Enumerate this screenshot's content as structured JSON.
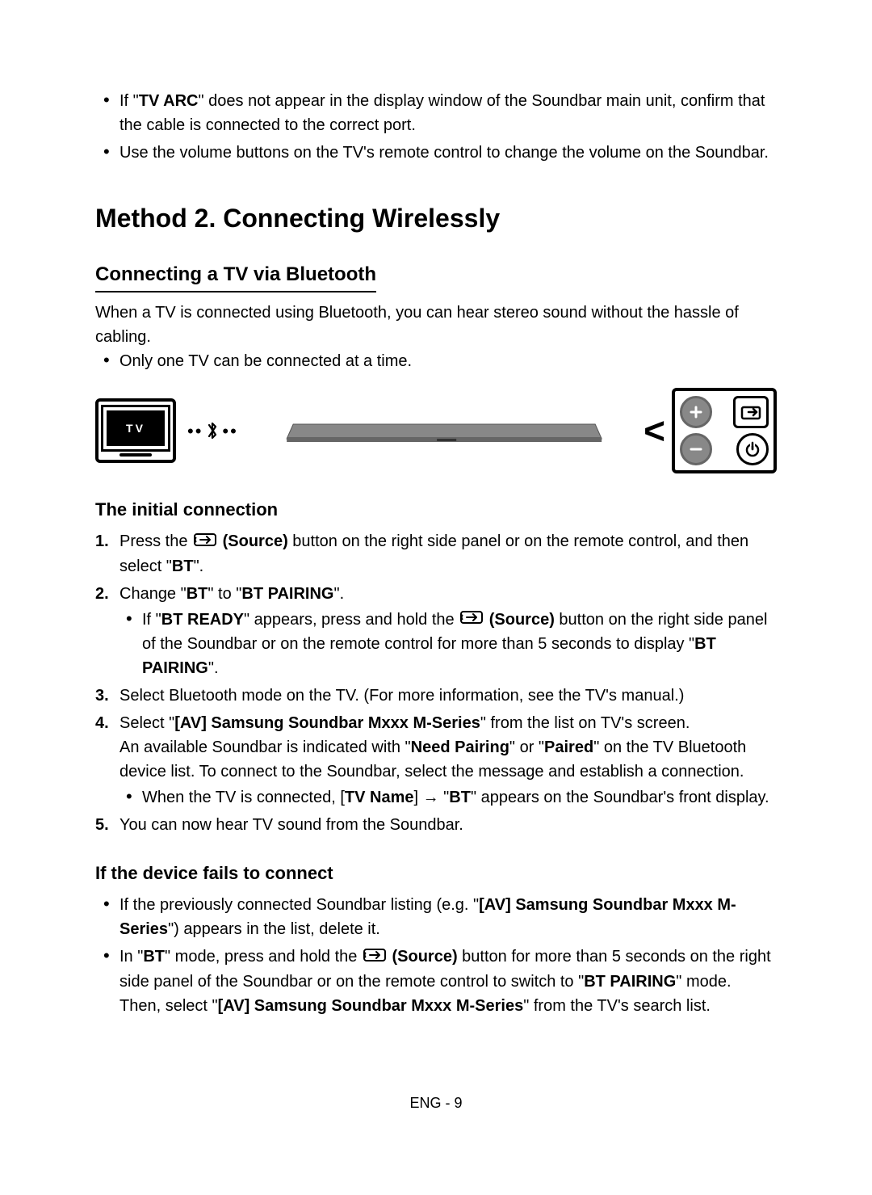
{
  "intro_bullets": [
    {
      "pre": "If \"",
      "bold1": "TV ARC",
      "post": "\" does not appear in the display window of the Soundbar main unit, confirm that the cable is connected to the correct port."
    },
    {
      "plain": "Use the volume buttons on the TV's remote control to change the volume on the Soundbar."
    }
  ],
  "method_title": "Method 2. Connecting Wirelessly",
  "subsection": "Connecting a TV via Bluetooth",
  "sub_desc": "When a TV is connected using Bluetooth, you can hear stereo sound without the hassle of cabling.",
  "sub_bullet": "Only one TV can be connected at a time.",
  "diagram": {
    "tv_label": "TV"
  },
  "initial_conn_title": "The initial connection",
  "source_label": "(Source)",
  "steps": {
    "s1_a": "Press the ",
    "s1_b": " button on the right side panel or on the remote control, and then select \"",
    "s1_bold": "BT",
    "s1_c": "\".",
    "s2_a": "Change \"",
    "s2_b1": "BT",
    "s2_b": "\" to \"",
    "s2_b2": "BT PAIRING",
    "s2_c": "\".",
    "s2_sub_a": "If \"",
    "s2_sub_b": "BT READY",
    "s2_sub_c": "\" appears, press and hold the ",
    "s2_sub_d": " button on the right side panel of the Soundbar or on the remote control for more than 5 seconds to display \"",
    "s2_sub_e": "BT PAIRING",
    "s2_sub_f": "\".",
    "s3": "Select Bluetooth mode on the TV. (For more information, see the TV's manual.)",
    "s4_a": "Select \"",
    "s4_b": "[AV] Samsung Soundbar Mxxx M-Series",
    "s4_c": "\" from the list on TV's screen.",
    "s4_d": "An available Soundbar is indicated with \"",
    "s4_e": "Need Pairing",
    "s4_f": "\" or \"",
    "s4_g": "Paired",
    "s4_h": "\" on the TV Bluetooth device list. To connect to the Soundbar, select the message and establish a connection.",
    "s4_sub_a": "When the TV is connected, [",
    "s4_sub_b": "TV Name",
    "s4_sub_c": "] → \"",
    "s4_sub_d": "BT",
    "s4_sub_e": "\" appears on the Soundbar's front display.",
    "s5": "You can now hear TV sound from the Soundbar."
  },
  "fail_title": "If the device fails to connect",
  "fail": {
    "b1_a": "If the previously connected Soundbar listing (e.g. \"",
    "b1_b": "[AV] Samsung Soundbar Mxxx M-Series",
    "b1_c": "\") appears in the list, delete it.",
    "b2_a": "In \"",
    "b2_b": "BT",
    "b2_c": "\" mode, press and hold the ",
    "b2_d": " button for more than 5 seconds on the right side panel of the Soundbar or on the remote control to switch to \"",
    "b2_e": "BT PAIRING",
    "b2_f": "\" mode.",
    "b2_g": "Then, select \"",
    "b2_h": "[AV] Samsung Soundbar Mxxx M-Series",
    "b2_i": "\" from the TV's search list."
  },
  "page_num": "ENG - 9"
}
